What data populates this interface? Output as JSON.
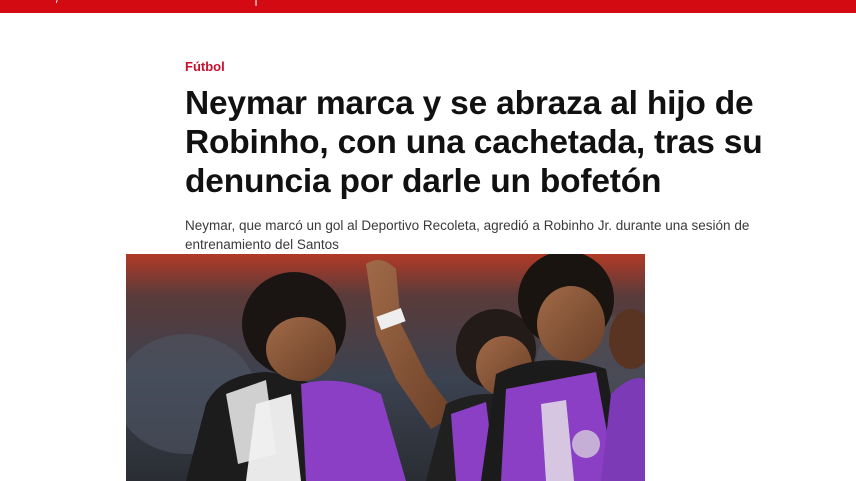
{
  "header": {
    "brand_color": "#d40a12"
  },
  "article": {
    "section": "Fútbol",
    "headline": "Neymar marca y se abraza al hijo de Robinho, con una cachetada, tras su denuncia por darle un bofetón",
    "subheadline": "Neymar, que marcó un gol al  Deportivo Recoleta, agredió a Robinho Jr. durante una sesión de entrenamiento del Santos",
    "section_color": "#c8102e"
  },
  "photo": {
    "kit_color": "#7a3fb0"
  }
}
